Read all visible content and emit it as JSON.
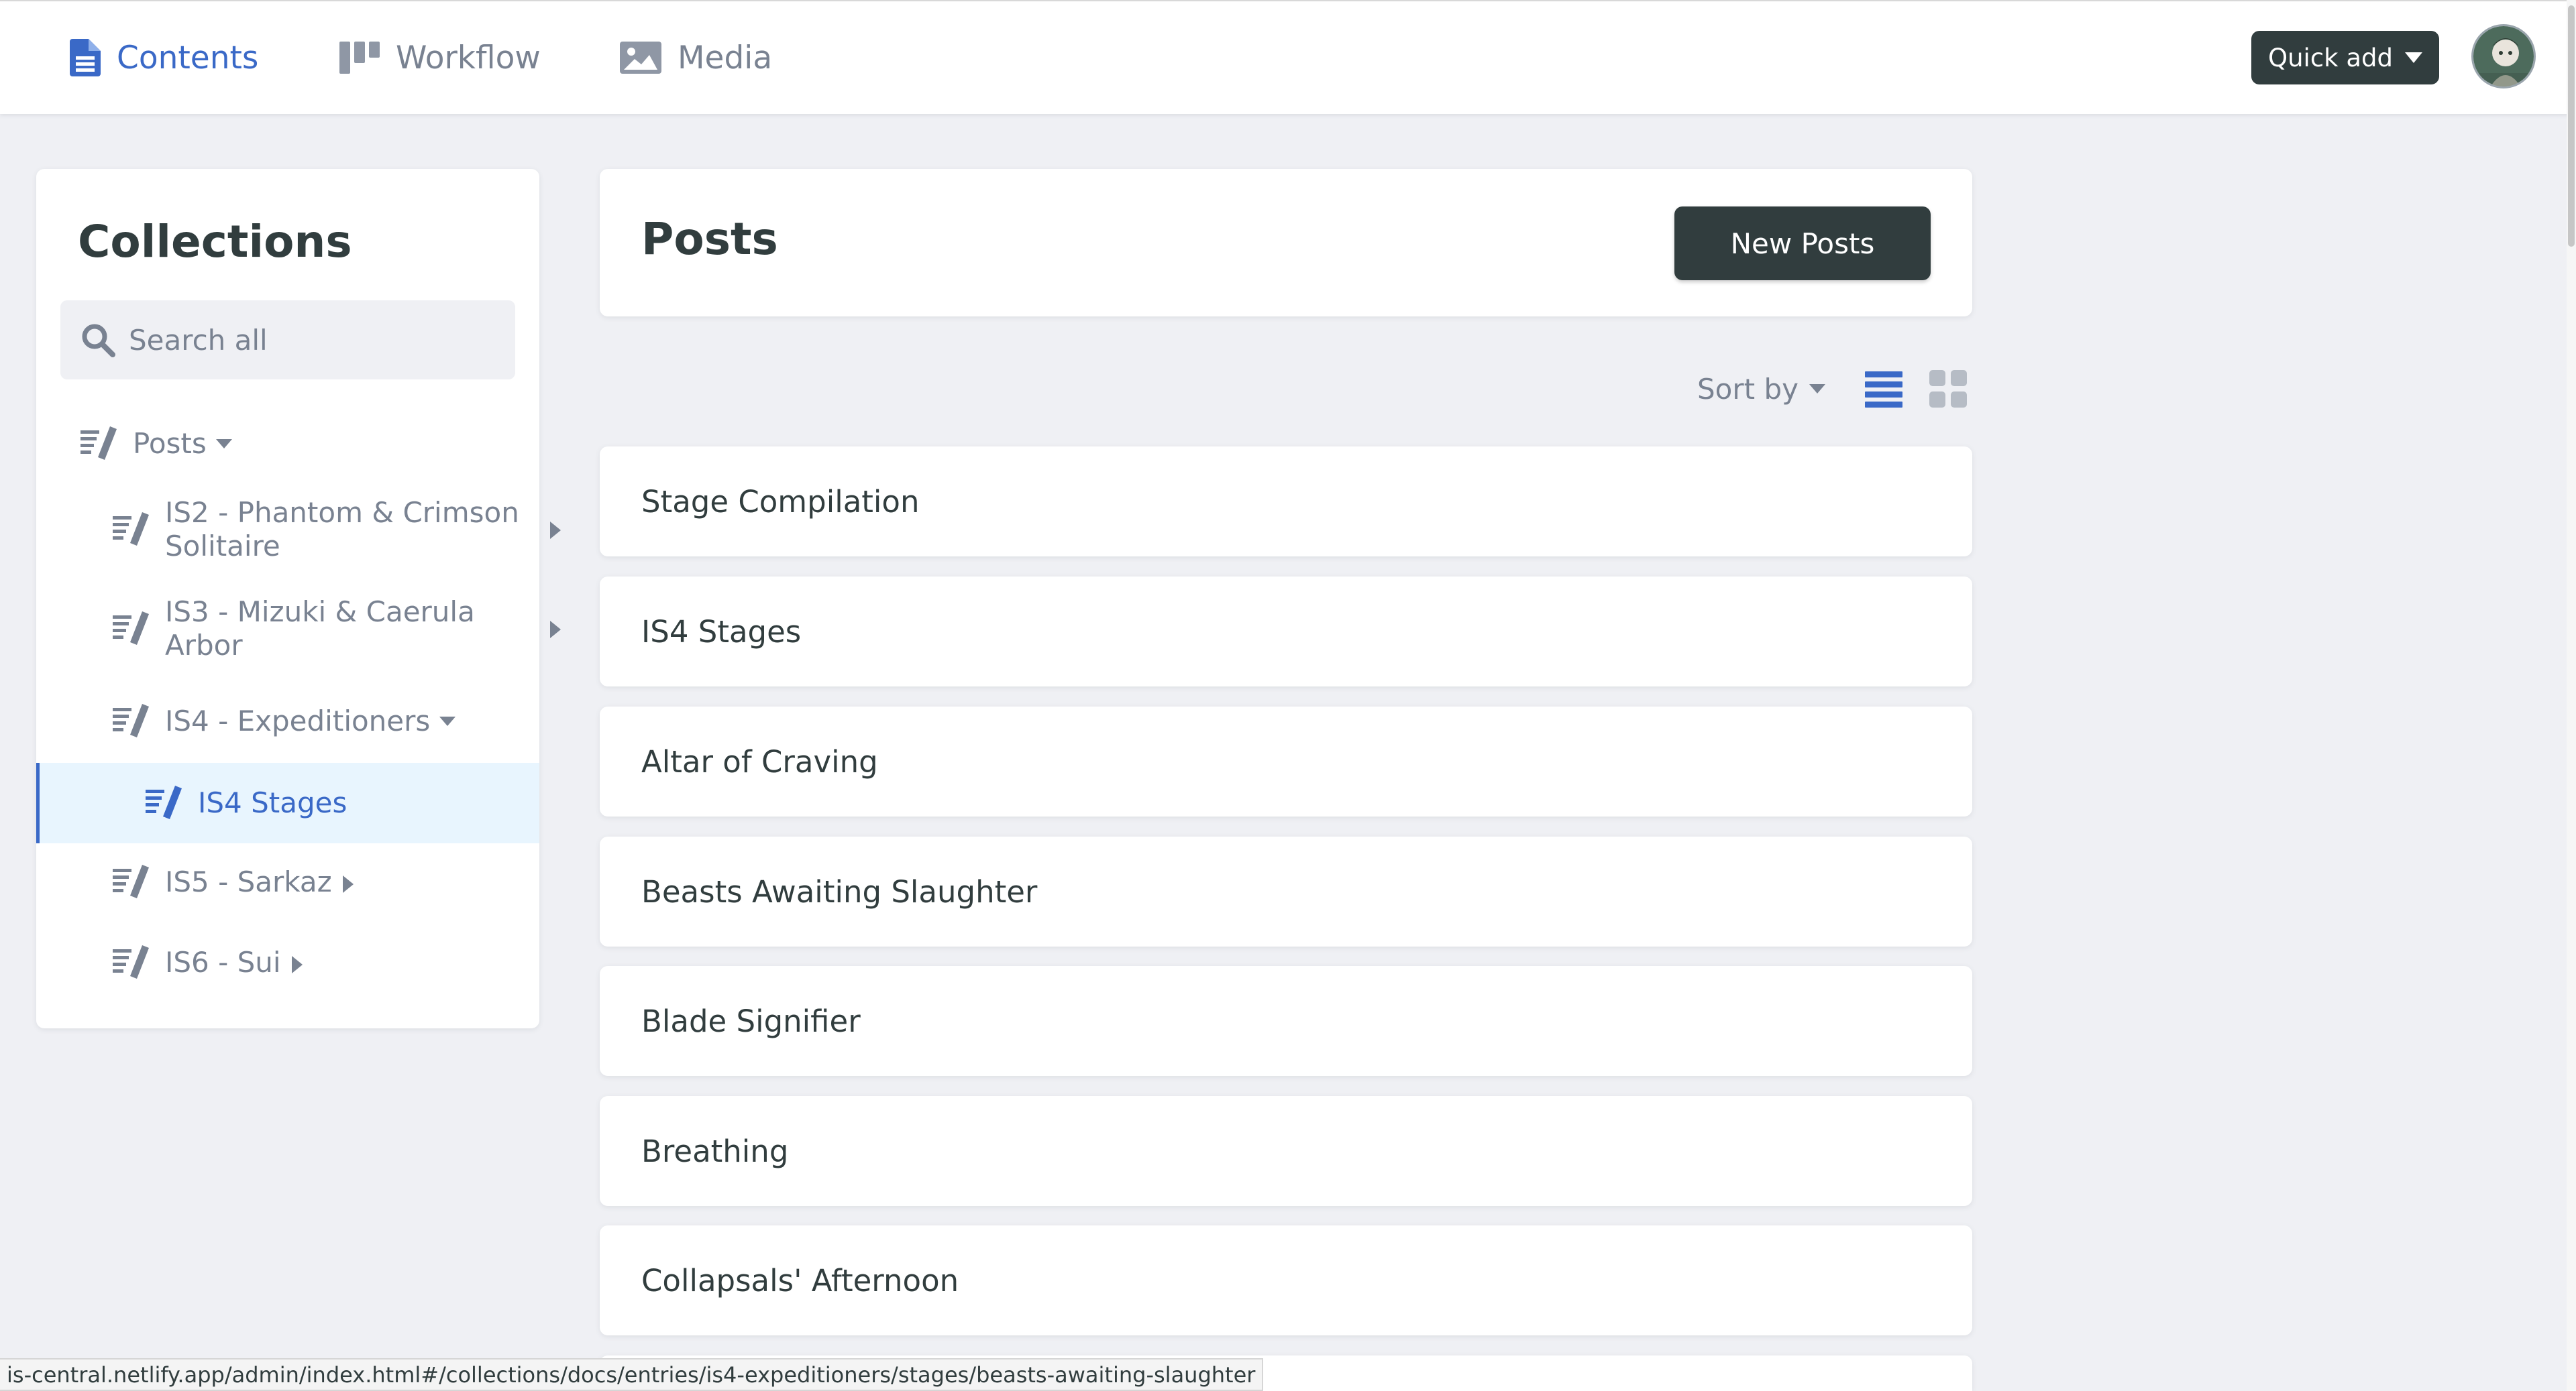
{
  "topnav": {
    "items": [
      {
        "label": "Contents",
        "icon": "document-icon",
        "active": true
      },
      {
        "label": "Workflow",
        "icon": "kanban-icon",
        "active": false
      },
      {
        "label": "Media",
        "icon": "image-icon",
        "active": false
      }
    ],
    "quick_add_label": "Quick add"
  },
  "sidebar": {
    "title": "Collections",
    "search_placeholder": "Search all",
    "items": [
      {
        "label": "Posts",
        "expanded": true
      },
      {
        "label": "IS2 - Phantom & Crimson Solitaire",
        "line1": "IS2 - Phantom & Crimson",
        "line2": "Solitaire",
        "expanded": false
      },
      {
        "label": "IS3 - Mizuki & Caerula Arbor",
        "line1": "IS3 - Mizuki & Caerula",
        "line2": "Arbor",
        "expanded": false
      },
      {
        "label": "IS4 - Expeditioners",
        "expanded": true
      },
      {
        "label": "IS4 Stages",
        "selected": true
      },
      {
        "label": "IS5 - Sarkaz",
        "expanded": false
      },
      {
        "label": "IS6 - Sui",
        "expanded": false
      }
    ]
  },
  "main": {
    "title": "Posts",
    "new_button_label": "New Posts",
    "sort_label": "Sort by",
    "entries": [
      "Stage Compilation",
      "IS4 Stages",
      "Altar of Craving",
      "Beasts Awaiting Slaughter",
      "Blade Signifier",
      "Breathing",
      "Collapsals' Afternoon"
    ]
  },
  "status_url": "is-central.netlify.app/admin/index.html#/collections/docs/entries/is4-expeditioners/stages/beasts-awaiting-slaughter",
  "colors": {
    "accent": "#3a69c7",
    "dark_button": "#313d3e",
    "background": "#eff0f4",
    "muted_text": "#798291"
  }
}
